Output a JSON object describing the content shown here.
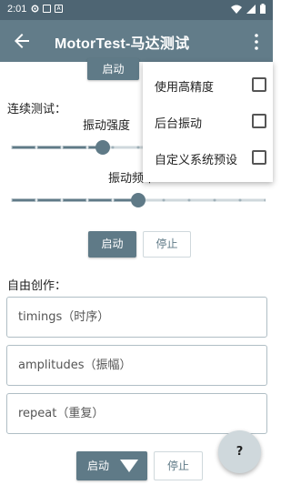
{
  "status_bar": {
    "time": "2:01",
    "notif_icons": [
      "gear-icon",
      "square-icon",
      "a-icon"
    ],
    "right_icons": [
      "wifi-icon",
      "signal-icon",
      "battery-icon"
    ]
  },
  "app_bar": {
    "title": "MotorTest-马达测试",
    "back_icon": "arrow-left-icon",
    "more_icon": "more-vert-icon"
  },
  "single": {
    "start_label": "启动"
  },
  "continuous": {
    "section_label": "连续测试：",
    "intensity_label": "振动强度",
    "frequency_label": "振动频率",
    "intensity_fraction": 0.36,
    "frequency_fraction": 0.5,
    "start_label": "启动",
    "stop_label": "停止"
  },
  "free": {
    "section_label": "自由创作：",
    "timings_placeholder": "timings（时序）",
    "amplitudes_placeholder": "amplitudes（振幅）",
    "repeat_placeholder": "repeat（重复）",
    "start_label": "启动",
    "stop_label": "停止"
  },
  "menu": {
    "items": [
      {
        "label": "使用高精度",
        "checked": false
      },
      {
        "label": "后台振动",
        "checked": false
      },
      {
        "label": "自定义系统预设",
        "checked": false
      }
    ]
  },
  "fab": {
    "label": "?"
  },
  "colors": {
    "primary": "#5f7a87",
    "app_bar": "#627c89",
    "status_bar": "#4e6573"
  }
}
